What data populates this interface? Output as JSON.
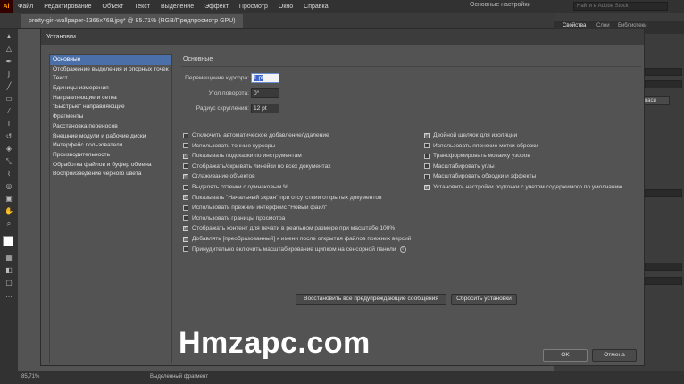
{
  "menubar": {
    "logo": "Ai",
    "items": [
      "Файл",
      "Редактирование",
      "Объект",
      "Текст",
      "Выделение",
      "Эффект",
      "Просмотр",
      "Окно",
      "Справка"
    ],
    "workspace": "Основные настройки",
    "search_placeholder": "Найти в Adobe Stock"
  },
  "document_tab": {
    "title": "pretty-girl-wallpaper-1366x768.jpg* @ 85.71% (RGB/Предпросмотр GPU)"
  },
  "right_panel": {
    "tabs": [
      "Свойства",
      "Слои",
      "Библиотеки"
    ],
    "button_label": "обласи"
  },
  "statusbar": {
    "zoom": "85,71%",
    "tool": "Выделенный фрагмент"
  },
  "dialog": {
    "title": "Установки",
    "categories": [
      "Основные",
      "Отображение выделения и опорных точек",
      "Текст",
      "Единицы измерения",
      "Направляющие и сетка",
      "\"Быстрые\" направляющие",
      "Фрагменты",
      "Расстановка переносов",
      "Внешние модули и рабочие диски",
      "Интерфейс пользователя",
      "Производительность",
      "Обработка файлов и буфер обмена",
      "Воспроизведение черного цвета"
    ],
    "section_title": "Основные",
    "fields": {
      "cursor_move": {
        "label": "Перемещение курсора:",
        "value": "1 pt"
      },
      "rotation_angle": {
        "label": "Угол поворота:",
        "value": "0°"
      },
      "corner_radius": {
        "label": "Радиус скругления:",
        "value": "12 pt"
      }
    },
    "options_left": [
      {
        "label": "Отключить автоматическое добавление/удаление",
        "checked": false
      },
      {
        "label": "Использовать точные курсоры",
        "checked": false
      },
      {
        "label": "Показывать подсказки по инструментам",
        "checked": true
      },
      {
        "label": "Отображать/скрывать линейки во всех документах",
        "checked": false
      },
      {
        "label": "Сглаживание объектов",
        "checked": true
      },
      {
        "label": "Выделять оттенки с одинаковым %",
        "checked": false
      },
      {
        "label": "Показывать \"Начальный экран\" при отсутствии открытых документов",
        "checked": true
      },
      {
        "label": "Использовать прежний интерфейс \"Новый файл\"",
        "checked": false
      },
      {
        "label": "Использовать границы просмотра",
        "checked": false
      },
      {
        "label": "Отображать контент для печати в реальном размере при масштабе 100%",
        "checked": true
      },
      {
        "label": "Добавлять [преобразованный] к имени после открытия файлов прежних версий",
        "checked": true
      },
      {
        "label": "Принудительно включить масштабирование щипком на сенсорной панели",
        "checked": false
      }
    ],
    "options_right": [
      {
        "label": "Двойной щелчок для изоляции",
        "checked": true
      },
      {
        "label": "Использовать японские метки обрезки",
        "checked": false
      },
      {
        "label": "Трансформировать мозаику узоров",
        "checked": false
      },
      {
        "label": "Масштабировать углы",
        "checked": false
      },
      {
        "label": "Масштабировать обводки и эффекты",
        "checked": false
      },
      {
        "label": "Установить настройки подгонки с учетом содержимого по умолчанию",
        "checked": true
      }
    ],
    "buttons": {
      "restore_warnings": "Восстановить все предупреждающие сообщения",
      "reset": "Сбросить установки",
      "ok": "OK",
      "cancel": "Отмена"
    }
  },
  "watermark": "Hmzapc.com"
}
